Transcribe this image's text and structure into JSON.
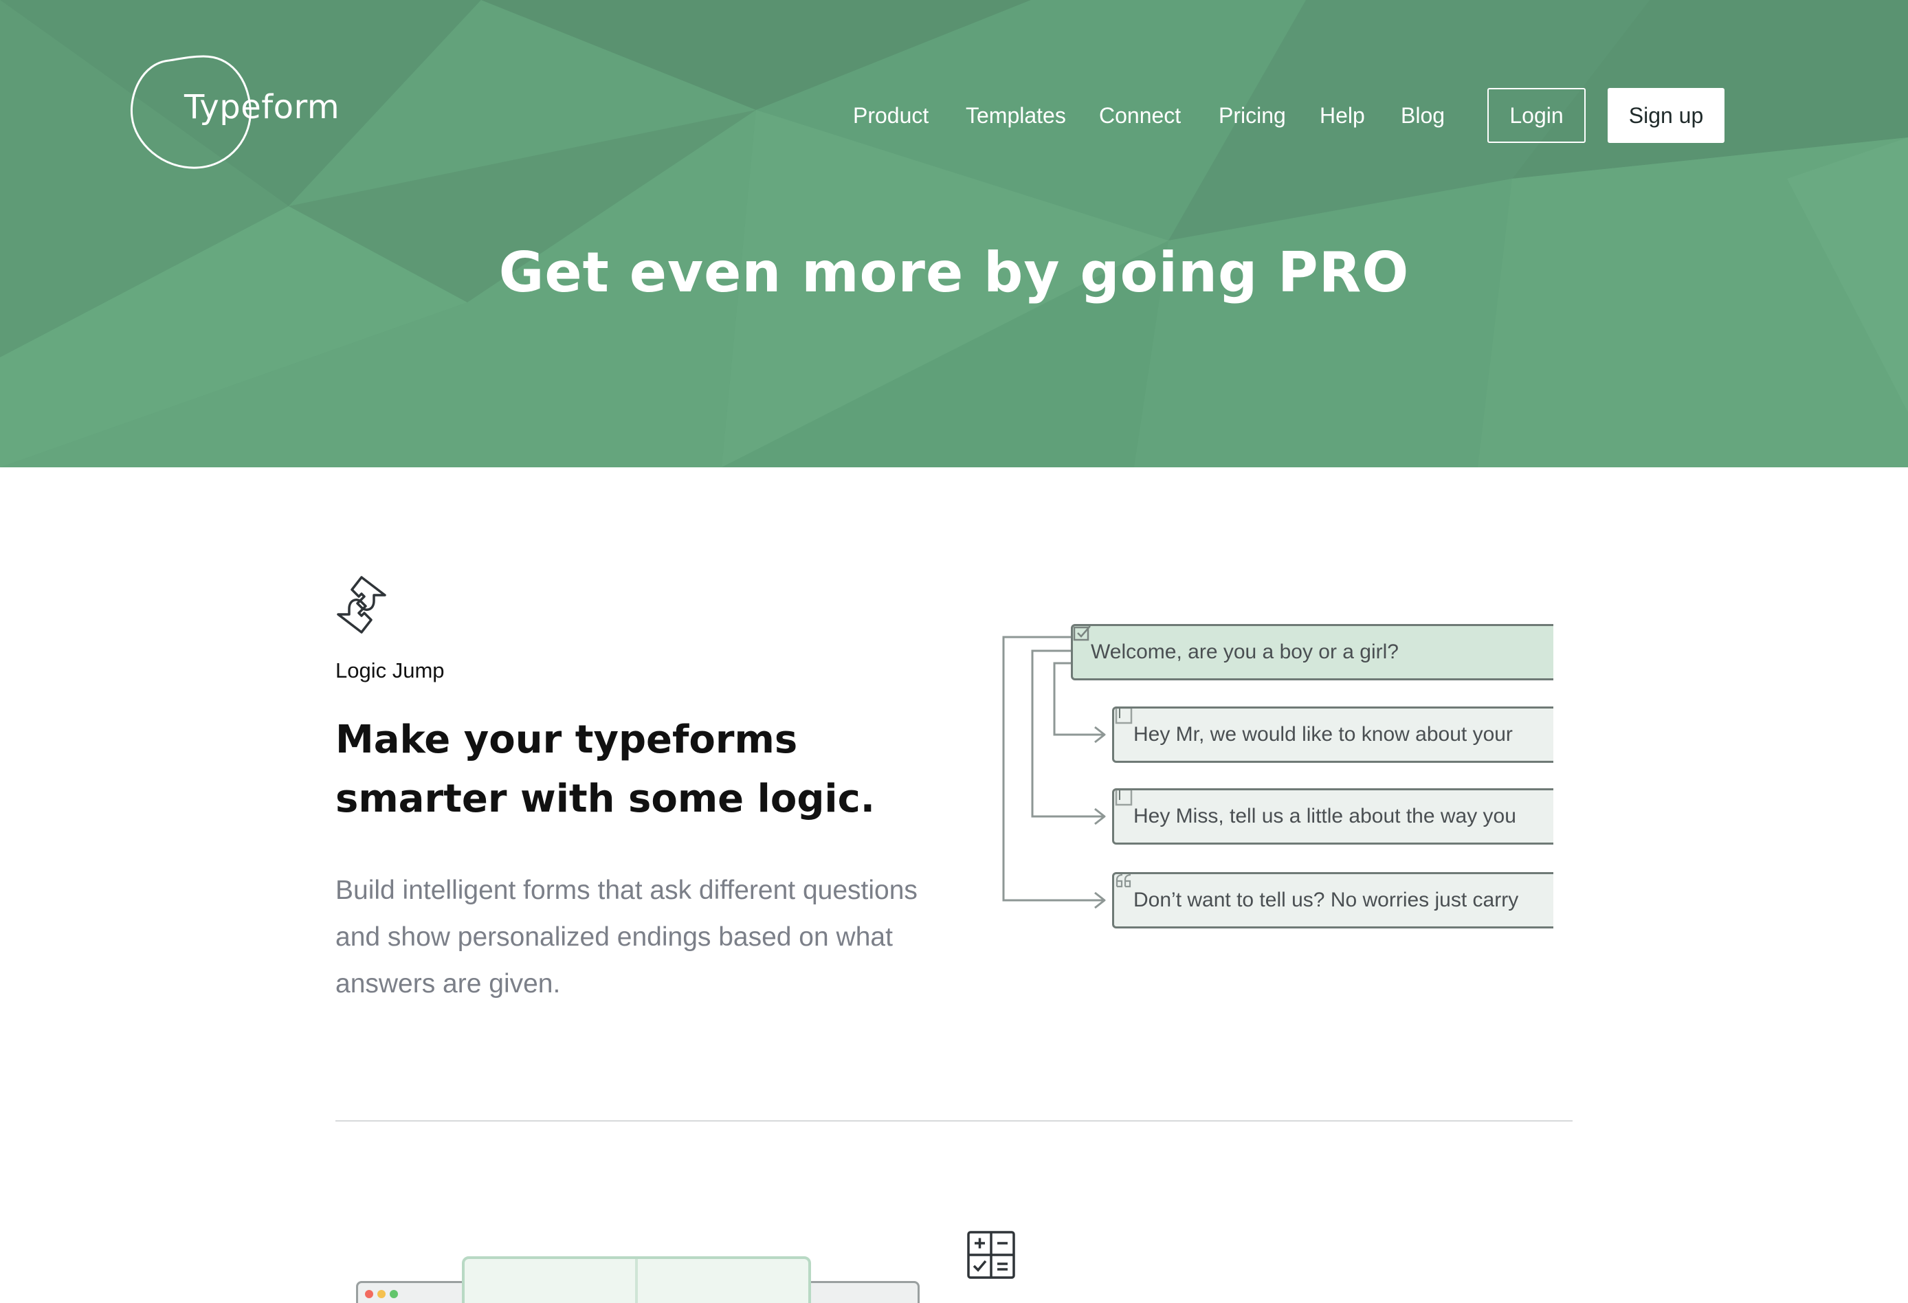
{
  "brand": {
    "name": "Typeform"
  },
  "nav": {
    "items": [
      "Product",
      "Templates",
      "Connect",
      "Pricing",
      "Help",
      "Blog"
    ],
    "login_label": "Login",
    "signup_label": "Sign up"
  },
  "hero": {
    "title": "Get even more by going PRO"
  },
  "feature_logic": {
    "icon": "logic-jump-arrows-icon",
    "eyebrow": "Logic Jump",
    "heading": "Make your typeforms smarter with some logic.",
    "description": "Build intelligent forms that ask different questions and show personalized endings based on what answers are given.",
    "diagram": {
      "question": "Welcome, are you a boy or a girl?",
      "branches": [
        "Hey Mr, we would like to know about your",
        "Hey Miss, tell us a little about the way you",
        "Don’t want to tell us? No worries just carry"
      ]
    }
  },
  "feature_calc": {
    "icon": "calculator-icon"
  },
  "colors": {
    "hero_green": "#61a07a",
    "node_question_bg": "#d4e7da",
    "node_branch_bg": "#ecf1ee",
    "body_text_gray": "#7b7f88"
  }
}
